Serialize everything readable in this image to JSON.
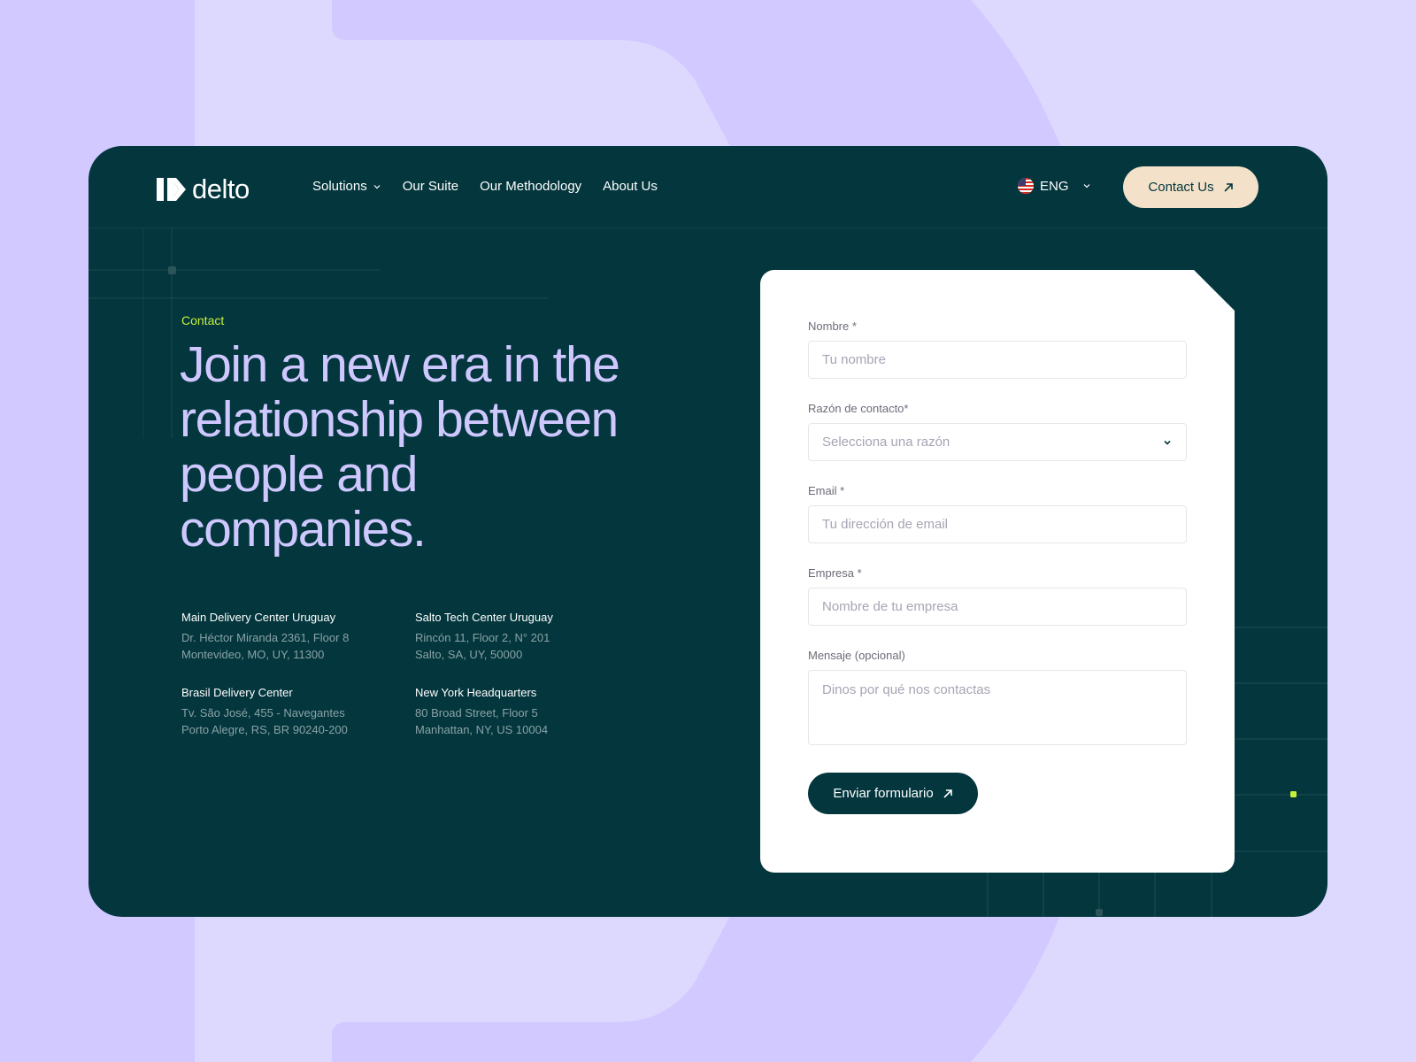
{
  "brand": {
    "name": "delto"
  },
  "nav": {
    "items": [
      {
        "label": "Solutions",
        "has_dropdown": true
      },
      {
        "label": "Our Suite"
      },
      {
        "label": "Our Methodology"
      },
      {
        "label": "About Us"
      }
    ],
    "language": {
      "label": "ENG",
      "flag": "us-flag-icon"
    },
    "cta": {
      "label": "Contact Us",
      "icon": "arrow-up-right-icon"
    }
  },
  "hero": {
    "eyebrow": "Contact",
    "headline": "Join a new era in the relationship between people and companies."
  },
  "offices": [
    {
      "name": "Main Delivery Center Uruguay",
      "line1": "Dr. Héctor Miranda 2361, Floor 8",
      "line2": "Montevideo, MO, UY, 11300"
    },
    {
      "name": "Salto Tech Center Uruguay",
      "line1": "Rincón 11, Floor 2, N° 201",
      "line2": "Salto, SA, UY, 50000"
    },
    {
      "name": "Brasil Delivery Center",
      "line1": "Tv. São José, 455 - Navegantes",
      "line2": "Porto Alegre, RS, BR 90240-200"
    },
    {
      "name": "New York Headquarters",
      "line1": "80 Broad Street, Floor 5",
      "line2": "Manhattan, NY, US 10004"
    }
  ],
  "form": {
    "name": {
      "label": "Nombre *",
      "placeholder": "Tu nombre",
      "value": ""
    },
    "reason": {
      "label": "Razón de contacto*",
      "placeholder": "Selecciona una razón"
    },
    "email": {
      "label": "Email *",
      "placeholder": "Tu dirección de email",
      "value": ""
    },
    "company": {
      "label": "Empresa *",
      "placeholder": "Nombre de tu empresa",
      "value": ""
    },
    "message": {
      "label": "Mensaje (opcional)",
      "placeholder": "Dinos por qué nos contactas",
      "value": ""
    },
    "submit": {
      "label": "Enviar formulario",
      "icon": "arrow-up-right-icon"
    }
  },
  "colors": {
    "frame_bg": "#03363d",
    "accent_lime": "#c7f03a",
    "headline_lavender": "#cfc8ff",
    "cta_cream": "#f3e1c9",
    "page_bg": "#d1c9ff"
  }
}
